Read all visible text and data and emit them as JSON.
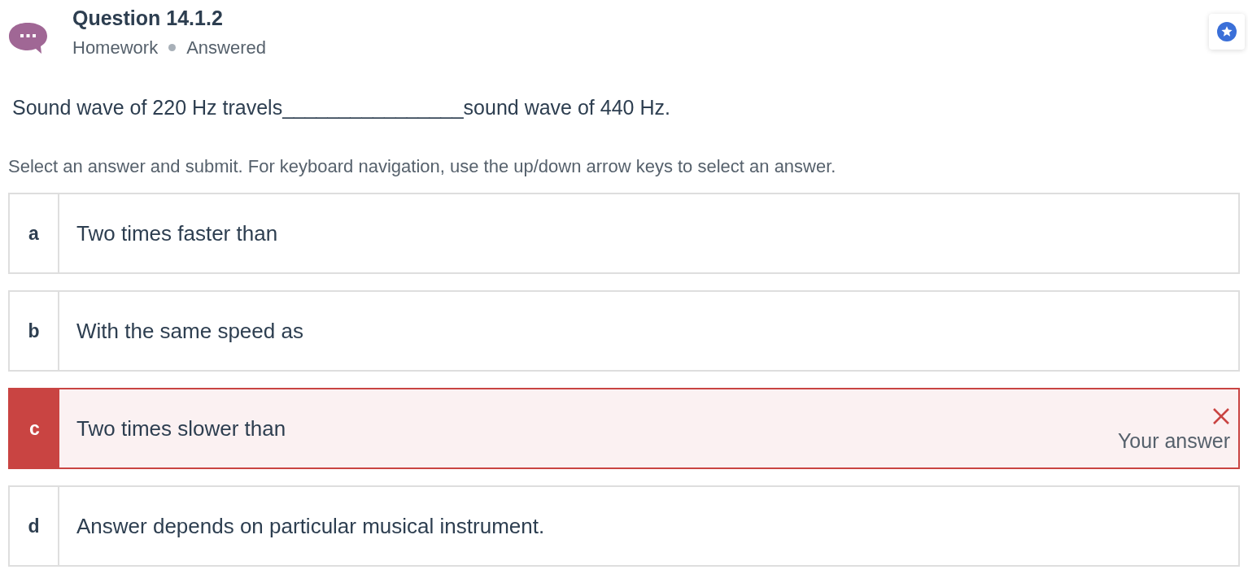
{
  "header": {
    "title": "Question 14.1.2",
    "category": "Homework",
    "status": "Answered"
  },
  "question": {
    "text": "Sound wave of 220 Hz travels________________sound wave of 440 Hz.",
    "instructions": "Select an answer and submit. For keyboard navigation, use the up/down arrow keys to select an answer."
  },
  "options": [
    {
      "letter": "a",
      "text": "Two times faster than",
      "selected": false,
      "incorrect": false
    },
    {
      "letter": "b",
      "text": "With the same speed as",
      "selected": false,
      "incorrect": false
    },
    {
      "letter": "c",
      "text": "Two times slower than",
      "selected": true,
      "incorrect": true,
      "note": "Your answer"
    },
    {
      "letter": "d",
      "text": "Answer depends on particular musical instrument.",
      "selected": false,
      "incorrect": false
    }
  ]
}
